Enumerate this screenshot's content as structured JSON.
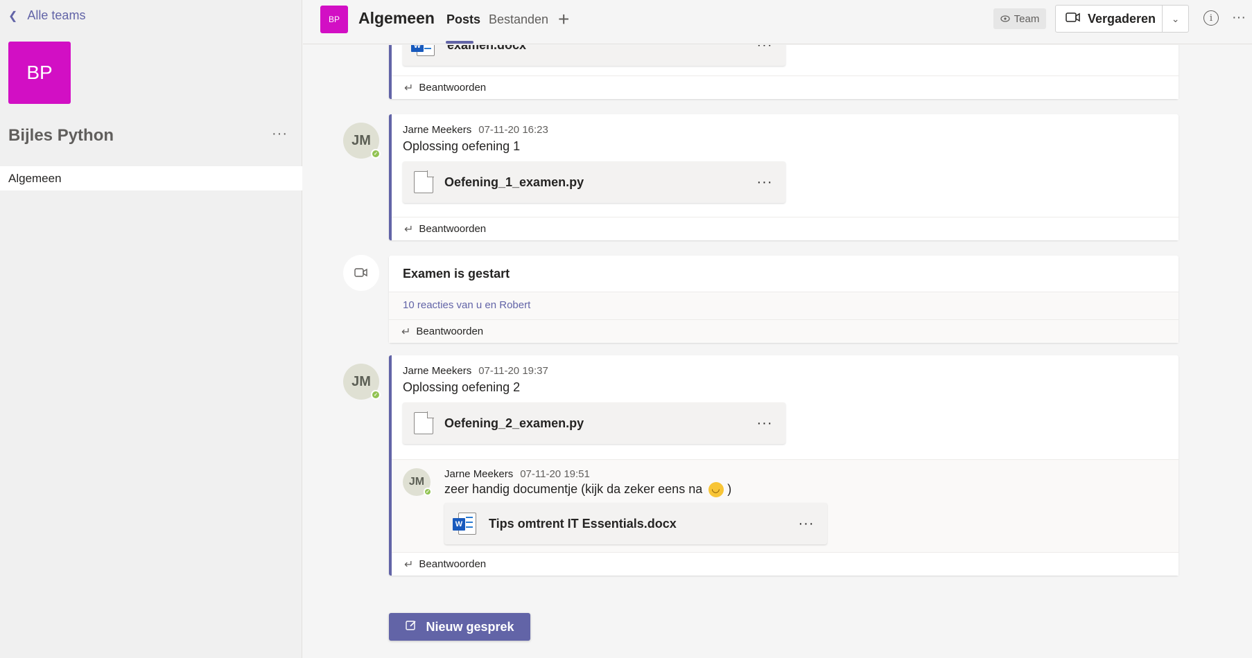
{
  "sidebar": {
    "back_label": "Alle teams",
    "team_initials": "BP",
    "team_name": "Bijles Python",
    "channel": "Algemeen"
  },
  "header": {
    "initials": "BP",
    "channel_name": "Algemeen",
    "tabs": [
      "Posts",
      "Bestanden"
    ],
    "team_badge": "Team",
    "meet_label": "Vergaderen"
  },
  "posts": [
    {
      "file": "examen.docx",
      "reply": "Beantwoorden"
    },
    {
      "avatar": "JM",
      "author": "Jarne Meekers",
      "time": "07-11-20 16:23",
      "text": "Oplossing oefening 1",
      "file": "Oefening_1_examen.py",
      "reply": "Beantwoorden"
    },
    {
      "title": "Examen is gestart",
      "reactions": "10 reacties van u en Robert",
      "reply": "Beantwoorden"
    },
    {
      "avatar": "JM",
      "author": "Jarne Meekers",
      "time": "07-11-20 19:37",
      "text": "Oplossing oefening 2",
      "file": "Oefening_2_examen.py",
      "reply_post": {
        "avatar": "JM",
        "author": "Jarne Meekers",
        "time": "07-11-20 19:51",
        "text": "zeer handig documentje (kijk da zeker eens na",
        "text_end": ")",
        "file": "Tips omtrent IT Essentials.docx"
      },
      "reply": "Beantwoorden"
    }
  ],
  "new_conversation": "Nieuw gesprek",
  "colors": {
    "accent": "#6264a7",
    "team_tile": "#d20fc4",
    "presence": "#92c353"
  }
}
